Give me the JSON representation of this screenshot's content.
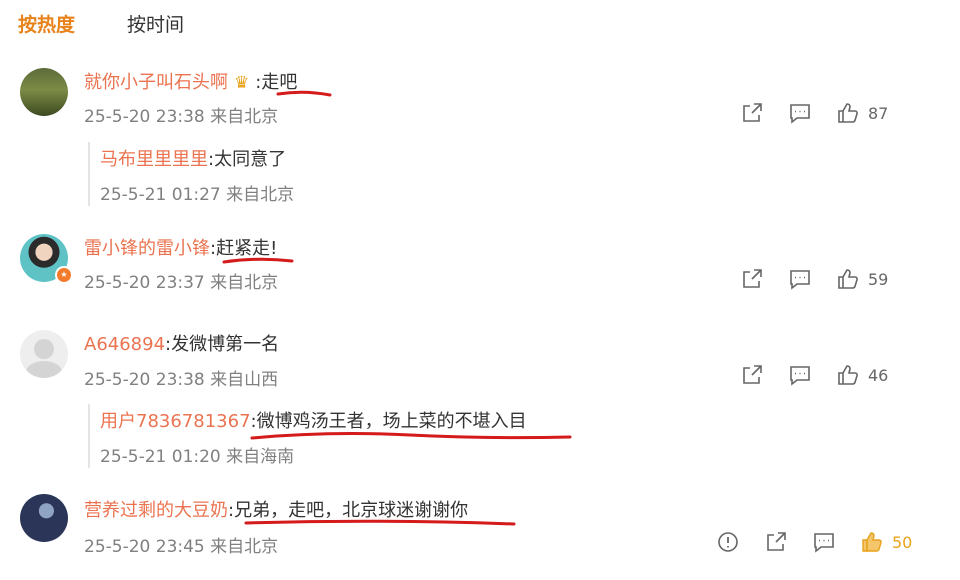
{
  "tabs": {
    "hot": "按热度",
    "time": "按时间"
  },
  "comments": [
    {
      "user": "就你小子叫石头啊",
      "text": ":走吧",
      "time": "25-5-20 23:38 来自北京",
      "likes": "87",
      "reply": {
        "user": "马布里里里里",
        "text": ":太同意了",
        "time": "25-5-21 01:27 来自北京"
      }
    },
    {
      "user": "雷小锋的雷小锋",
      "text": ":赶紧走!",
      "time": "25-5-20 23:37 来自北京",
      "likes": "59"
    },
    {
      "user": "A646894",
      "text": ":发微博第一名",
      "time": "25-5-20 23:38 来自山西",
      "likes": "46",
      "reply": {
        "user": "用户7836781367",
        "text": ":微博鸡汤王者，场上菜的不堪入目",
        "time": "25-5-21 01:20 来自海南"
      }
    },
    {
      "user": "营养过剩的大豆奶",
      "text": ":兄弟，走吧，北京球迷谢谢你",
      "time": "25-5-20 23:45 来自北京",
      "likes": "50"
    }
  ],
  "colors": {
    "accent": "#e8821a",
    "username": "#eb7350",
    "underline": "#d41a1a",
    "like_active": "#e8a21a"
  },
  "icons": {
    "share": "share-icon",
    "comment": "comment-icon",
    "like": "thumbs-up-icon",
    "report": "report-icon",
    "crown": "crown-badge-icon"
  }
}
